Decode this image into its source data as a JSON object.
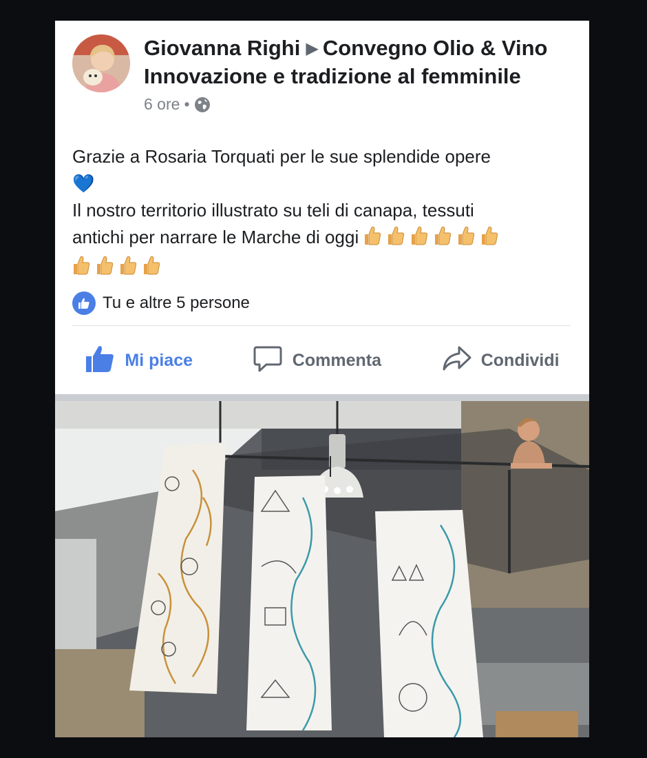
{
  "post": {
    "author": "Giovanna Righi",
    "arrow": "▶",
    "group": "Convegno Olio & Vino",
    "group_line2": "Innovazione e tradizione al femminile",
    "time": "6 ore",
    "separator": "•",
    "privacy_icon": "globe-icon",
    "text_line1": "Grazie a Rosaria Torquati per le sue splendide opere",
    "text_heart": "💙",
    "text_line3": "Il nostro territorio illustrato su teli di canapa,  tessuti",
    "text_line4": "antichi per narrare le Marche di oggi",
    "thumbs_count_line4": 6,
    "thumbs_count_line5": 4,
    "reactions_text": "Tu e altre 5 persone"
  },
  "actions": {
    "like_label": "Mi piace",
    "comment_label": "Commenta",
    "share_label": "Condividi"
  },
  "colors": {
    "accent": "#4b7fe6",
    "text": "#1c1e21",
    "muted": "#606770"
  }
}
